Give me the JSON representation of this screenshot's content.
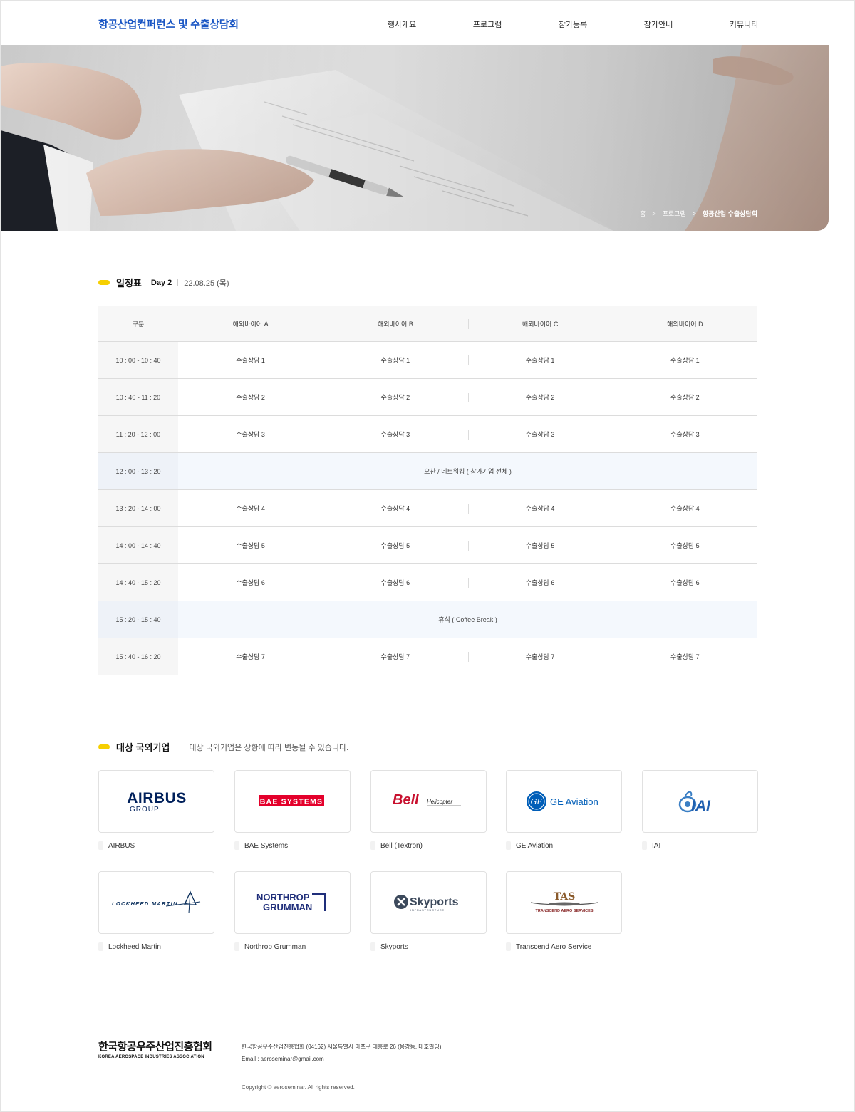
{
  "header": {
    "logo": "항공산업컨퍼런스 및 수출상담회",
    "nav": [
      "행사개요",
      "프로그램",
      "참가등록",
      "참가안내",
      "커뮤니티"
    ]
  },
  "breadcrumb": {
    "home": "홈",
    "sep": ">",
    "level1": "프로그램",
    "current": "항공산업 수출상담회"
  },
  "schedule": {
    "title": "일정표",
    "day": "Day 2",
    "date": "22.08.25 (목)",
    "header": [
      "구분",
      "해외바이어 A",
      "해외바이어 B",
      "해외바이어 C",
      "해외바이어 D"
    ],
    "rows": [
      {
        "time": "10 : 00  -  10 : 40",
        "cells": [
          "수출상담 1",
          "수출상담 1",
          "수출상담 1",
          "수출상담 1"
        ]
      },
      {
        "time": "10 : 40  -  11 : 20",
        "cells": [
          "수출상담 2",
          "수출상담 2",
          "수출상담 2",
          "수출상담 2"
        ]
      },
      {
        "time": "11 : 20  -  12 : 00",
        "cells": [
          "수출상담 3",
          "수출상담 3",
          "수출상담 3",
          "수출상담 3"
        ]
      },
      {
        "time": "12 : 00  -  13 : 20",
        "span": "오찬 / 네트워킹 ( 참가기업 전체 )"
      },
      {
        "time": "13 : 20  -  14 : 00",
        "cells": [
          "수출상담 4",
          "수출상담 4",
          "수출상담 4",
          "수출상담 4"
        ]
      },
      {
        "time": "14 : 00  -  14 : 40",
        "cells": [
          "수출상담 5",
          "수출상담 5",
          "수출상담 5",
          "수출상담 5"
        ]
      },
      {
        "time": "14 : 40  -  15 : 20",
        "cells": [
          "수출상담 6",
          "수출상담 6",
          "수출상담 6",
          "수출상담 6"
        ]
      },
      {
        "time": "15 : 20  -  15 : 40",
        "span": "휴식 ( Coffee Break )"
      },
      {
        "time": "15 : 40  -  16 : 20",
        "cells": [
          "수출상담 7",
          "수출상담 7",
          "수출상담 7",
          "수출상담 7"
        ]
      }
    ]
  },
  "companies": {
    "title": "대상 국외기업",
    "note": "대상 국외기업은 상황에 따라 변동될 수 있습니다.",
    "items": [
      {
        "name": "AIRBUS",
        "logo_text": "AIRBUS",
        "logo_sub": "GROUP"
      },
      {
        "name": "BAE Systems",
        "logo_text": "BAE SYSTEMS"
      },
      {
        "name": "Bell (Textron)",
        "logo_text": "Bell",
        "logo_sub": "Helicopter"
      },
      {
        "name": "GE Aviation",
        "logo_text": "GE Aviation"
      },
      {
        "name": "IAI",
        "logo_text": "IAI"
      },
      {
        "name": "Lockheed Martin",
        "logo_text": "LOCKHEED MARTIN"
      },
      {
        "name": "Northrop Grumman",
        "logo_text": "NORTHROP",
        "logo_sub": "GRUMMAN"
      },
      {
        "name": "Skyports",
        "logo_text": "Skyports",
        "logo_sub": "INFRASTRUCTURE"
      },
      {
        "name": "Transcend Aero Service",
        "logo_text": "TAS",
        "logo_sub": "TRANSCEND AERO SERVICES"
      }
    ]
  },
  "footer": {
    "org_ko": "한국항공우주산업진흥협회",
    "org_en": "KOREA AEROSPACE INDUSTRIES ASSOCIATION",
    "address": "한국항공우주산업진흥협회    (04162) 서울특별시 마포구 대흥로 26 (용강동, 대호빌딩)",
    "email": "Email : aeroseminar@gmail.com",
    "copyright": "Copyright © aeroseminar. All rights reserved."
  },
  "colors": {
    "brand": "#1a56c4",
    "accent": "#f6cf00",
    "break_row": "#f4f8fd"
  }
}
